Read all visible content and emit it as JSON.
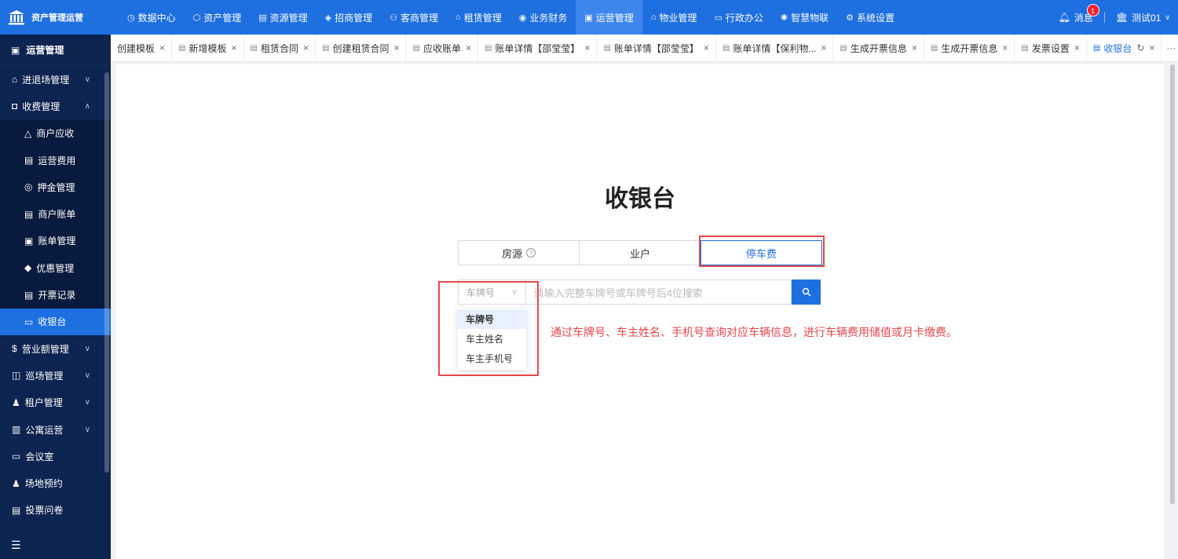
{
  "brand": {
    "name": "资产管理运营"
  },
  "topnav": {
    "items": [
      {
        "label": "数据中心",
        "icon": "clock-icon"
      },
      {
        "label": "资产管理",
        "icon": "cube-icon"
      },
      {
        "label": "资源管理",
        "icon": "chart-icon"
      },
      {
        "label": "招商管理",
        "icon": "tag-icon"
      },
      {
        "label": "客商管理",
        "icon": "people-icon"
      },
      {
        "label": "租赁管理",
        "icon": "building-icon"
      },
      {
        "label": "业务财务",
        "icon": "coin-icon"
      },
      {
        "label": "运营管理",
        "icon": "ops-icon",
        "active": true
      },
      {
        "label": "物业管理",
        "icon": "home-icon"
      },
      {
        "label": "行政办公",
        "icon": "monitor-icon"
      },
      {
        "label": "智慧物联",
        "icon": "iot-icon"
      },
      {
        "label": "系统设置",
        "icon": "gear-icon"
      }
    ],
    "messages_label": "消息",
    "messages_count": "1",
    "user_label": "测试01"
  },
  "sidebar": {
    "title": "运营管理",
    "items": [
      {
        "label": "进退场管理",
        "expandable": true
      },
      {
        "label": "收费管理",
        "expandable": true,
        "expanded": true
      },
      {
        "label": "营业额管理",
        "expandable": true
      },
      {
        "label": "巡场管理",
        "expandable": true
      },
      {
        "label": "租户管理",
        "expandable": true
      },
      {
        "label": "公寓运营",
        "expandable": true
      },
      {
        "label": "会议室"
      },
      {
        "label": "场地预约"
      },
      {
        "label": "投票问卷"
      }
    ],
    "sub_items": [
      {
        "label": "商户应收"
      },
      {
        "label": "运营费用"
      },
      {
        "label": "押金管理"
      },
      {
        "label": "商户账单"
      },
      {
        "label": "账单管理"
      },
      {
        "label": "优惠管理"
      },
      {
        "label": "开票记录"
      },
      {
        "label": "收银台",
        "active": true
      }
    ]
  },
  "tabs": [
    {
      "label": "创建模板"
    },
    {
      "label": "新增模板"
    },
    {
      "label": "租赁合同"
    },
    {
      "label": "创建租赁合同"
    },
    {
      "label": "应收账单"
    },
    {
      "label": "账单详情【邵莹莹】"
    },
    {
      "label": "账单详情【邵莹莹】"
    },
    {
      "label": "账单详情【保利物..."
    },
    {
      "label": "生成开票信息"
    },
    {
      "label": "生成开票信息"
    },
    {
      "label": "发票设置"
    },
    {
      "label": "收银台",
      "active": true
    }
  ],
  "more_label": "更多",
  "main": {
    "title": "收银台",
    "segments": [
      {
        "label": "房源"
      },
      {
        "label": "业户"
      },
      {
        "label": "停车费",
        "active": true
      }
    ],
    "select_value": "车牌号",
    "search_placeholder": "请输入完整车牌号或车牌号后4位搜索",
    "dropdown_options": [
      "车牌号",
      "车主姓名",
      "车主手机号"
    ],
    "hint": "通过车牌号、车主姓名、手机号查询对应车辆信息，进行车辆费用储值或月卡缴费。"
  },
  "colors": {
    "primary": "#1e6fe0",
    "sidebar": "#0d2350",
    "annotation": "#e5484d"
  }
}
